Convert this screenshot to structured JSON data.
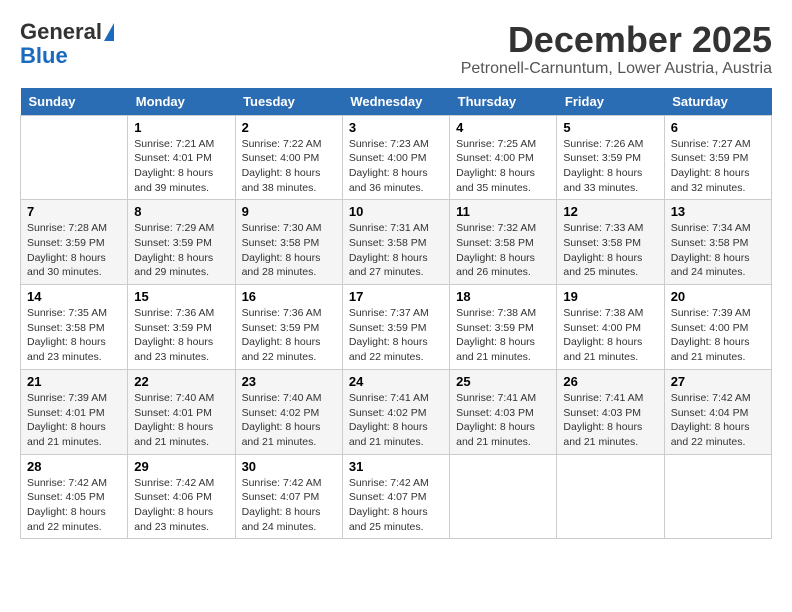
{
  "header": {
    "logo_general": "General",
    "logo_blue": "Blue",
    "title": "December 2025",
    "subtitle": "Petronell-Carnuntum, Lower Austria, Austria"
  },
  "weekdays": [
    "Sunday",
    "Monday",
    "Tuesday",
    "Wednesday",
    "Thursday",
    "Friday",
    "Saturday"
  ],
  "weeks": [
    [
      {
        "day": "",
        "info": ""
      },
      {
        "day": "1",
        "info": "Sunrise: 7:21 AM\nSunset: 4:01 PM\nDaylight: 8 hours\nand 39 minutes."
      },
      {
        "day": "2",
        "info": "Sunrise: 7:22 AM\nSunset: 4:00 PM\nDaylight: 8 hours\nand 38 minutes."
      },
      {
        "day": "3",
        "info": "Sunrise: 7:23 AM\nSunset: 4:00 PM\nDaylight: 8 hours\nand 36 minutes."
      },
      {
        "day": "4",
        "info": "Sunrise: 7:25 AM\nSunset: 4:00 PM\nDaylight: 8 hours\nand 35 minutes."
      },
      {
        "day": "5",
        "info": "Sunrise: 7:26 AM\nSunset: 3:59 PM\nDaylight: 8 hours\nand 33 minutes."
      },
      {
        "day": "6",
        "info": "Sunrise: 7:27 AM\nSunset: 3:59 PM\nDaylight: 8 hours\nand 32 minutes."
      }
    ],
    [
      {
        "day": "7",
        "info": "Sunrise: 7:28 AM\nSunset: 3:59 PM\nDaylight: 8 hours\nand 30 minutes."
      },
      {
        "day": "8",
        "info": "Sunrise: 7:29 AM\nSunset: 3:59 PM\nDaylight: 8 hours\nand 29 minutes."
      },
      {
        "day": "9",
        "info": "Sunrise: 7:30 AM\nSunset: 3:58 PM\nDaylight: 8 hours\nand 28 minutes."
      },
      {
        "day": "10",
        "info": "Sunrise: 7:31 AM\nSunset: 3:58 PM\nDaylight: 8 hours\nand 27 minutes."
      },
      {
        "day": "11",
        "info": "Sunrise: 7:32 AM\nSunset: 3:58 PM\nDaylight: 8 hours\nand 26 minutes."
      },
      {
        "day": "12",
        "info": "Sunrise: 7:33 AM\nSunset: 3:58 PM\nDaylight: 8 hours\nand 25 minutes."
      },
      {
        "day": "13",
        "info": "Sunrise: 7:34 AM\nSunset: 3:58 PM\nDaylight: 8 hours\nand 24 minutes."
      }
    ],
    [
      {
        "day": "14",
        "info": "Sunrise: 7:35 AM\nSunset: 3:58 PM\nDaylight: 8 hours\nand 23 minutes."
      },
      {
        "day": "15",
        "info": "Sunrise: 7:36 AM\nSunset: 3:59 PM\nDaylight: 8 hours\nand 23 minutes."
      },
      {
        "day": "16",
        "info": "Sunrise: 7:36 AM\nSunset: 3:59 PM\nDaylight: 8 hours\nand 22 minutes."
      },
      {
        "day": "17",
        "info": "Sunrise: 7:37 AM\nSunset: 3:59 PM\nDaylight: 8 hours\nand 22 minutes."
      },
      {
        "day": "18",
        "info": "Sunrise: 7:38 AM\nSunset: 3:59 PM\nDaylight: 8 hours\nand 21 minutes."
      },
      {
        "day": "19",
        "info": "Sunrise: 7:38 AM\nSunset: 4:00 PM\nDaylight: 8 hours\nand 21 minutes."
      },
      {
        "day": "20",
        "info": "Sunrise: 7:39 AM\nSunset: 4:00 PM\nDaylight: 8 hours\nand 21 minutes."
      }
    ],
    [
      {
        "day": "21",
        "info": "Sunrise: 7:39 AM\nSunset: 4:01 PM\nDaylight: 8 hours\nand 21 minutes."
      },
      {
        "day": "22",
        "info": "Sunrise: 7:40 AM\nSunset: 4:01 PM\nDaylight: 8 hours\nand 21 minutes."
      },
      {
        "day": "23",
        "info": "Sunrise: 7:40 AM\nSunset: 4:02 PM\nDaylight: 8 hours\nand 21 minutes."
      },
      {
        "day": "24",
        "info": "Sunrise: 7:41 AM\nSunset: 4:02 PM\nDaylight: 8 hours\nand 21 minutes."
      },
      {
        "day": "25",
        "info": "Sunrise: 7:41 AM\nSunset: 4:03 PM\nDaylight: 8 hours\nand 21 minutes."
      },
      {
        "day": "26",
        "info": "Sunrise: 7:41 AM\nSunset: 4:03 PM\nDaylight: 8 hours\nand 21 minutes."
      },
      {
        "day": "27",
        "info": "Sunrise: 7:42 AM\nSunset: 4:04 PM\nDaylight: 8 hours\nand 22 minutes."
      }
    ],
    [
      {
        "day": "28",
        "info": "Sunrise: 7:42 AM\nSunset: 4:05 PM\nDaylight: 8 hours\nand 22 minutes."
      },
      {
        "day": "29",
        "info": "Sunrise: 7:42 AM\nSunset: 4:06 PM\nDaylight: 8 hours\nand 23 minutes."
      },
      {
        "day": "30",
        "info": "Sunrise: 7:42 AM\nSunset: 4:07 PM\nDaylight: 8 hours\nand 24 minutes."
      },
      {
        "day": "31",
        "info": "Sunrise: 7:42 AM\nSunset: 4:07 PM\nDaylight: 8 hours\nand 25 minutes."
      },
      {
        "day": "",
        "info": ""
      },
      {
        "day": "",
        "info": ""
      },
      {
        "day": "",
        "info": ""
      }
    ]
  ]
}
